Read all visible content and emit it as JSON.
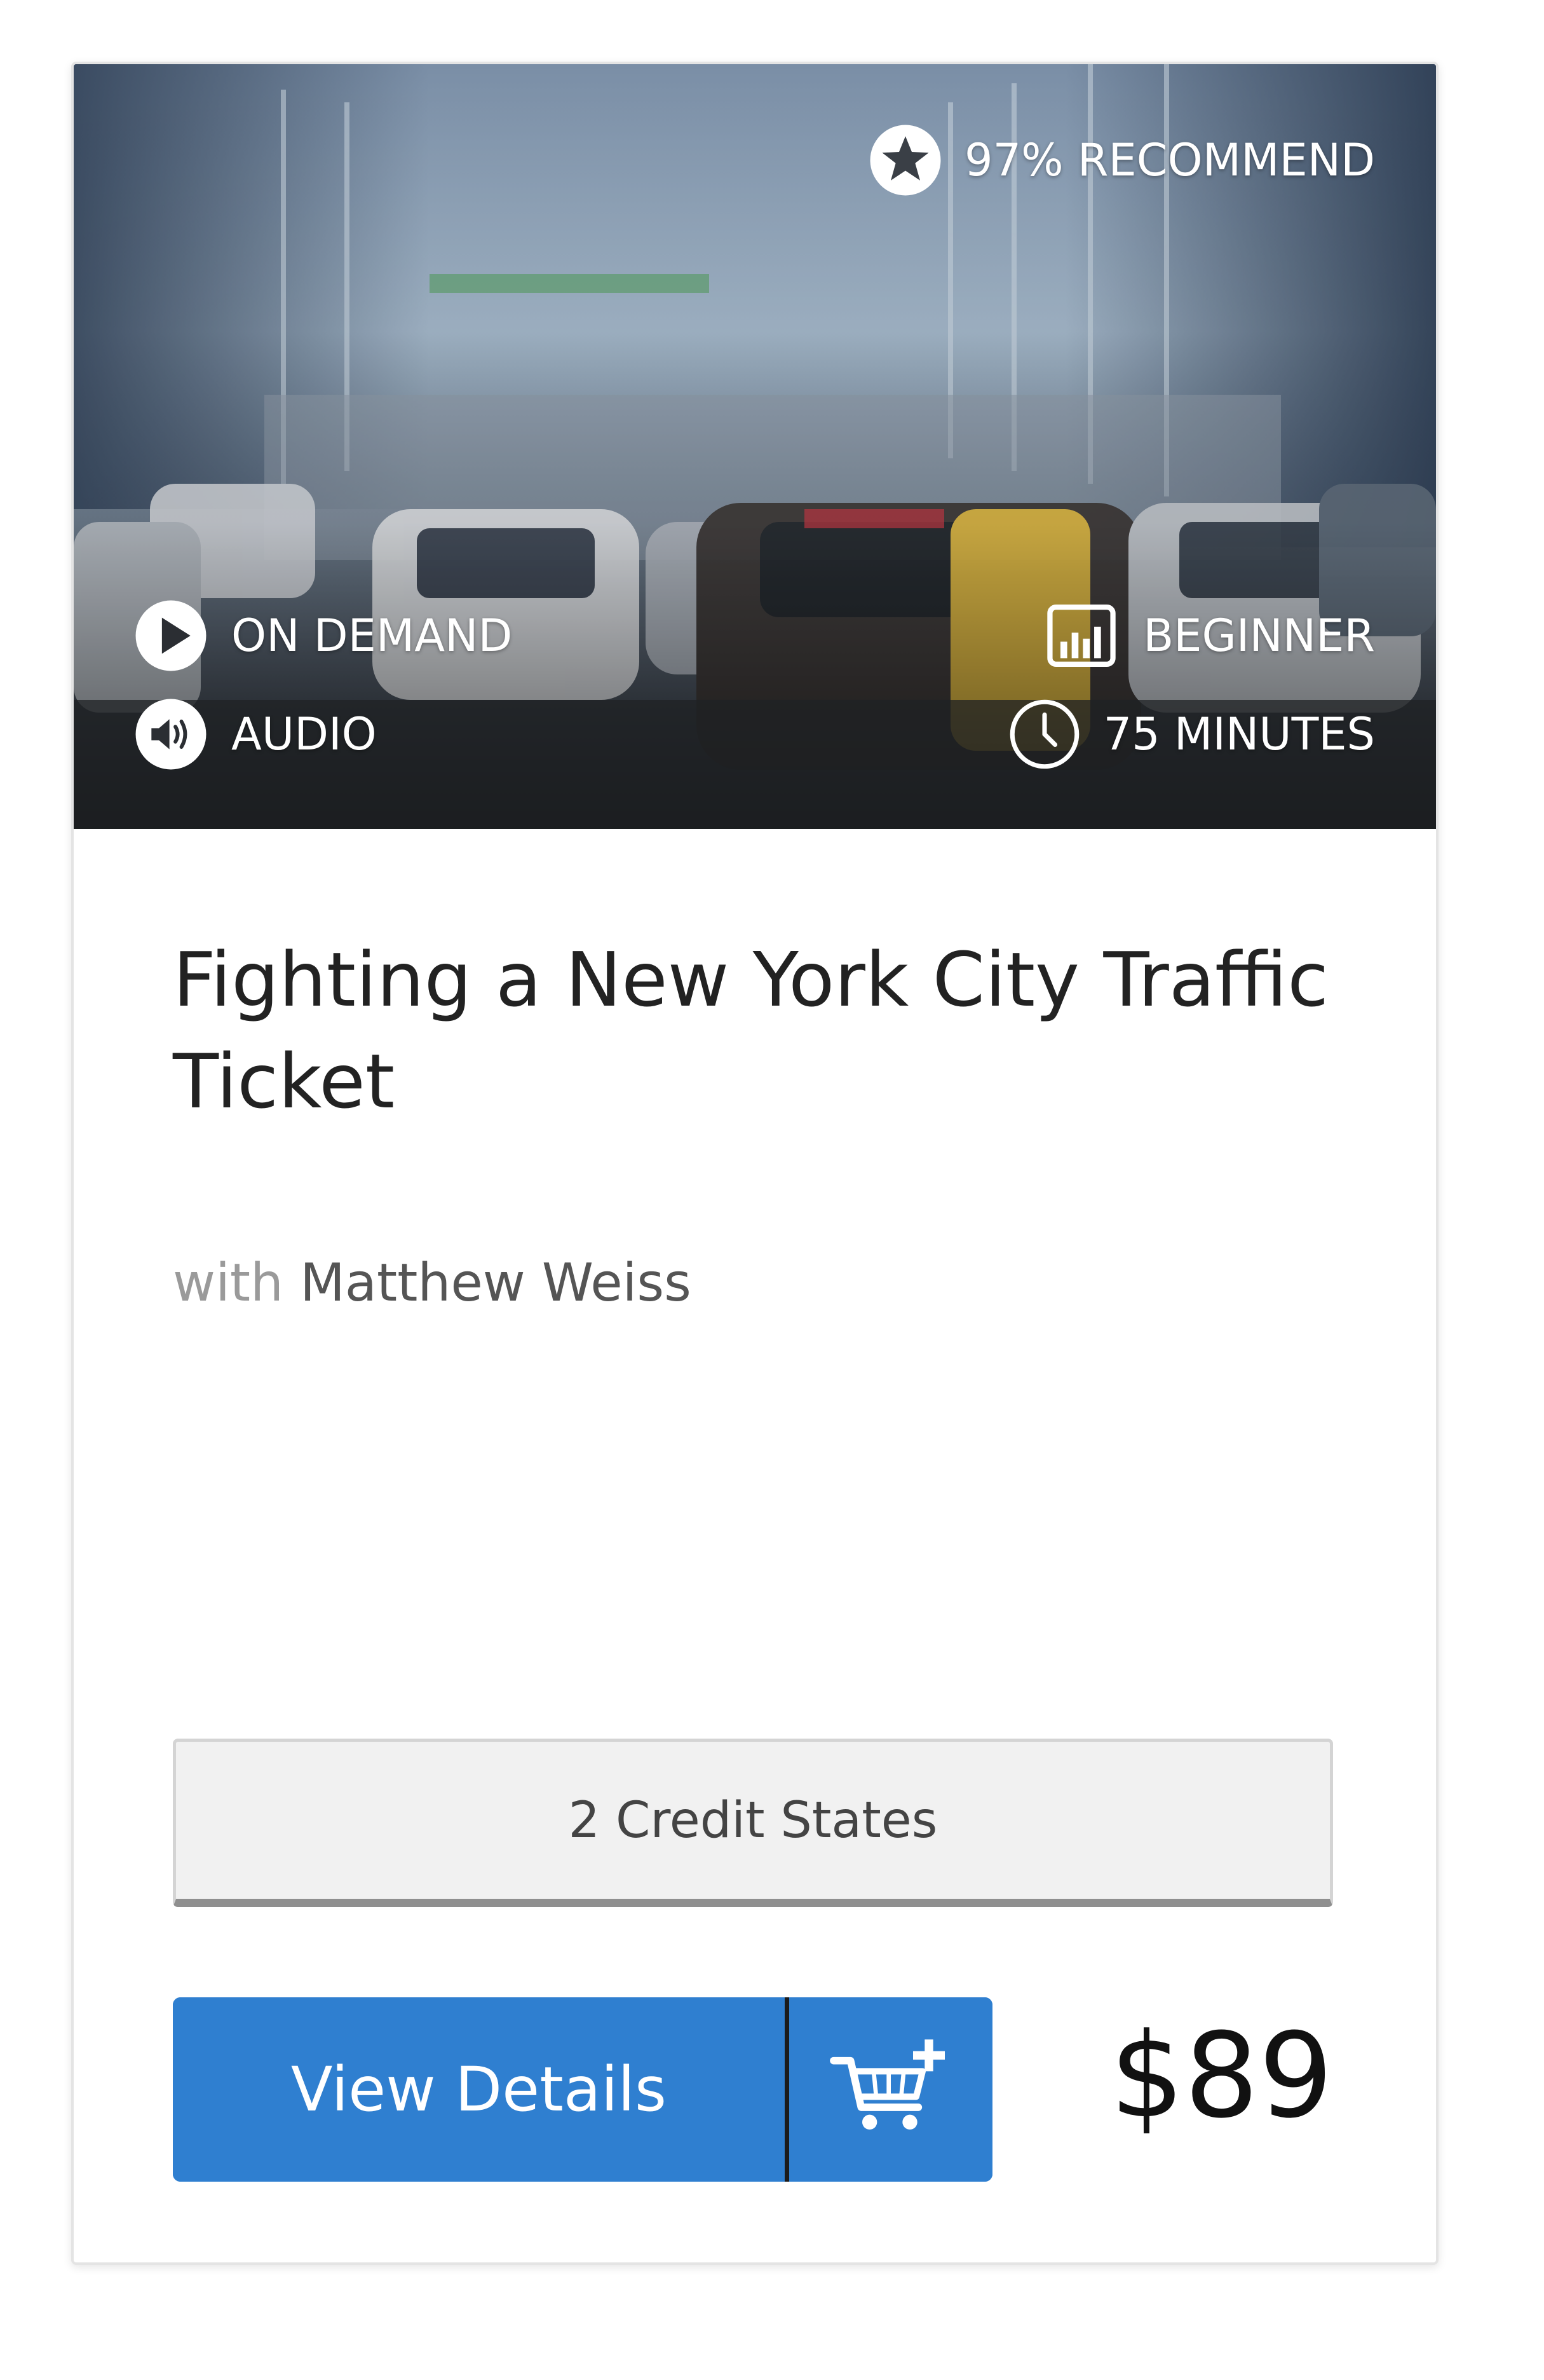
{
  "course": {
    "recommend": "97% RECOMMEND",
    "format": "ON DEMAND",
    "media": "AUDIO",
    "level": "BEGINNER",
    "duration": "75 MINUTES",
    "title": "Fighting a New York City Traffic Ticket",
    "instructor_prefix": "with",
    "instructor_name": "Matthew Weiss",
    "credit_states": "2 Credit States",
    "details_label": "View Details",
    "price": "$89"
  },
  "icons": {
    "recommend": "star-circle-icon",
    "format": "play-circle-icon",
    "media": "speaker-circle-icon",
    "level": "bar-chart-icon",
    "duration": "clock-icon",
    "cart": "add-to-cart-icon"
  },
  "colors": {
    "primary_button": "#2f7fd0",
    "price_text": "#111111",
    "title_text": "#222222"
  }
}
